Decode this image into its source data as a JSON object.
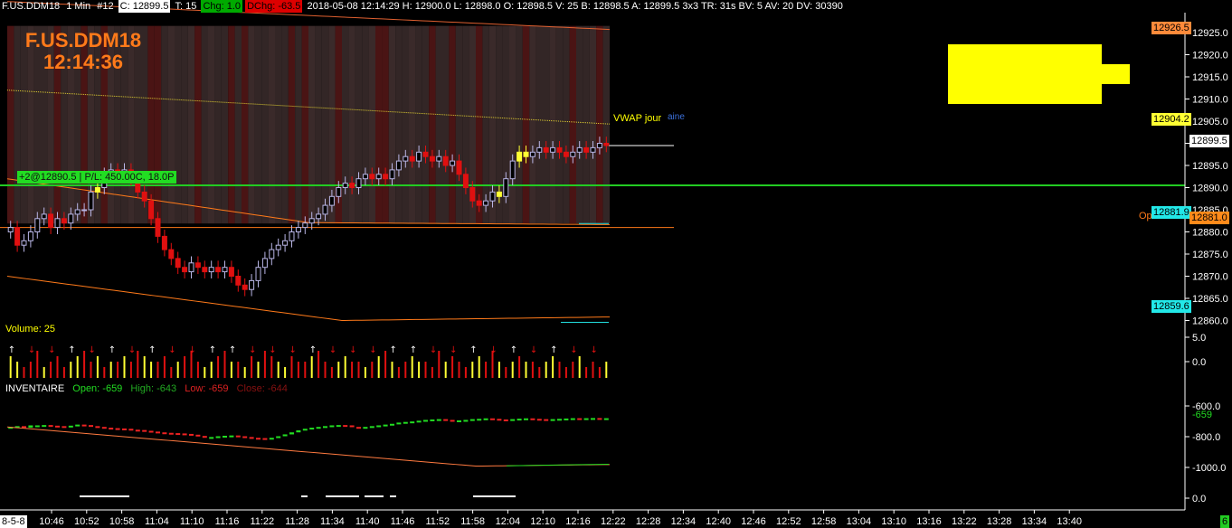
{
  "header": {
    "symbol": "F.US.DDM18",
    "interval": "1 Min",
    "bar_no": "#12",
    "close": "C: 12899.5",
    "ticks": "T: 15",
    "chg": "Chg: 1.0",
    "dchg": "DChg: -63.5",
    "stats": "2018-05-08 12:14:29 H: 12900.0 L: 12898.0 O: 12898.5 V: 25 B: 12898.5 A: 12899.5 3x3 TR: 31s BV: 5 AV: 20 DV: 30390"
  },
  "overlay": {
    "symbol": "F.US.DDM18",
    "time": "12:14:36"
  },
  "vwap_label": "VWAP jour",
  "vwap_suffix": "aine",
  "open_label": "Op",
  "position_label": "+2@12890.5 | P/L: 450.00C, 18.0P",
  "price_tags": {
    "upper": "12926.5",
    "vwap": "12904.2",
    "last": "12899.5",
    "lower_band": "12881.9",
    "open": "12881.0",
    "bottom_band": "12859.6"
  },
  "price_axis": [
    "12925.0",
    "12920.0",
    "12915.0",
    "12910.0",
    "12905.0",
    "12900.0",
    "12895.0",
    "12890.0",
    "12885.0",
    "12880.0",
    "12875.0",
    "12870.0",
    "12865.0",
    "12860.0"
  ],
  "volume": {
    "label": "Volume: 25",
    "axis": [
      "5.0",
      "0.0"
    ]
  },
  "inventory": {
    "title": "INVENTAIRE",
    "open": "Open: -659",
    "high": "High: -643",
    "low": "Low: -659",
    "close": "Close: -644",
    "axis": [
      "-600.0",
      "-800.0",
      "-1000.0",
      "0.0"
    ],
    "last_tag": "-659"
  },
  "time_axis": {
    "start": "8-5-8",
    "ticks": [
      "10:46",
      "10:52",
      "10:58",
      "11:04",
      "11:10",
      "11:16",
      "11:22",
      "11:28",
      "11:34",
      "11:40",
      "11:46",
      "11:52",
      "11:58",
      "12:04",
      "12:10",
      "12:16",
      "12:22",
      "12:28",
      "12:34",
      "12:40",
      "12:46",
      "12:52",
      "12:58",
      "13:04",
      "13:10",
      "13:16",
      "13:22",
      "13:28",
      "13:34",
      "13:40"
    ],
    "corner": "6"
  },
  "colors": {
    "up": "#b9b6e6",
    "down": "#e01010",
    "buy": "#ffff33",
    "green": "#22dd22",
    "orange": "#ff7a1a",
    "cyan": "#22e0e0",
    "yellow": "#ffff00"
  },
  "chart_data": {
    "type": "candlestick",
    "title": "F.US.DDM18 1 Min",
    "ylim": [
      12857,
      12930
    ],
    "closes": [
      12881,
      12877,
      12878,
      12880,
      12883,
      12884,
      12881,
      12883,
      12882,
      12884,
      12885,
      12885,
      12889,
      12890,
      12893,
      12894,
      12893,
      12894,
      12892,
      12889,
      12887,
      12883,
      12879,
      12876,
      12874,
      12872,
      12871,
      12873,
      12872,
      12871,
      12872,
      12871,
      12872,
      12870,
      12868,
      12867,
      12869,
      12872,
      12874,
      12876,
      12877,
      12878,
      12880,
      12881,
      12882,
      12883,
      12884,
      12886,
      12888,
      12890,
      12891,
      12890,
      12892,
      12893,
      12892,
      12893,
      12892,
      12894,
      12896,
      12897,
      12896,
      12898,
      12897,
      12896,
      12897,
      12895,
      12896,
      12893,
      12890,
      12887,
      12886,
      12887,
      12889,
      12888,
      12892,
      12896,
      12898,
      12897,
      12898,
      12899,
      12898,
      12899,
      12898,
      12897,
      12898,
      12899,
      12898,
      12899,
      12900,
      12899.5
    ],
    "volume": [
      4,
      3,
      2,
      3,
      5,
      2,
      3,
      4,
      2,
      3,
      4,
      5,
      3,
      4,
      2,
      3,
      3,
      4,
      3,
      5,
      4,
      3,
      3,
      4,
      2,
      3,
      4,
      5,
      3,
      2,
      3,
      4,
      5,
      3,
      3,
      2,
      4,
      3,
      5,
      4,
      3,
      2,
      4,
      3,
      3,
      4,
      5,
      3,
      2,
      3,
      4,
      3,
      3,
      2,
      3,
      4,
      5,
      3,
      2,
      3,
      4,
      3,
      3,
      2,
      5,
      3,
      4,
      3,
      2,
      3,
      4,
      3,
      5,
      3,
      2,
      3,
      4,
      3,
      3,
      2,
      3,
      4,
      3,
      2,
      3,
      4,
      2,
      3,
      2,
      3
    ],
    "inventory": [
      -700,
      -695,
      -705,
      -690,
      -690,
      -688,
      -692,
      -695,
      -700,
      -692,
      -685,
      -688,
      -695,
      -700,
      -705,
      -708,
      -710,
      -712,
      -718,
      -720,
      -725,
      -730,
      -735,
      -738,
      -740,
      -742,
      -745,
      -750,
      -758,
      -770,
      -765,
      -760,
      -757,
      -755,
      -760,
      -765,
      -770,
      -772,
      -775,
      -770,
      -760,
      -748,
      -735,
      -722,
      -712,
      -705,
      -700,
      -695,
      -690,
      -688,
      -690,
      -700,
      -705,
      -700,
      -695,
      -690,
      -685,
      -680,
      -672,
      -668,
      -665,
      -660,
      -655,
      -652,
      -650,
      -655,
      -660,
      -658,
      -655,
      -650,
      -648,
      -645,
      -648,
      -652,
      -656,
      -650,
      -647,
      -645,
      -648,
      -650,
      -652,
      -650,
      -648,
      -646,
      -644,
      -645,
      -644,
      -643,
      -644,
      -644
    ]
  }
}
